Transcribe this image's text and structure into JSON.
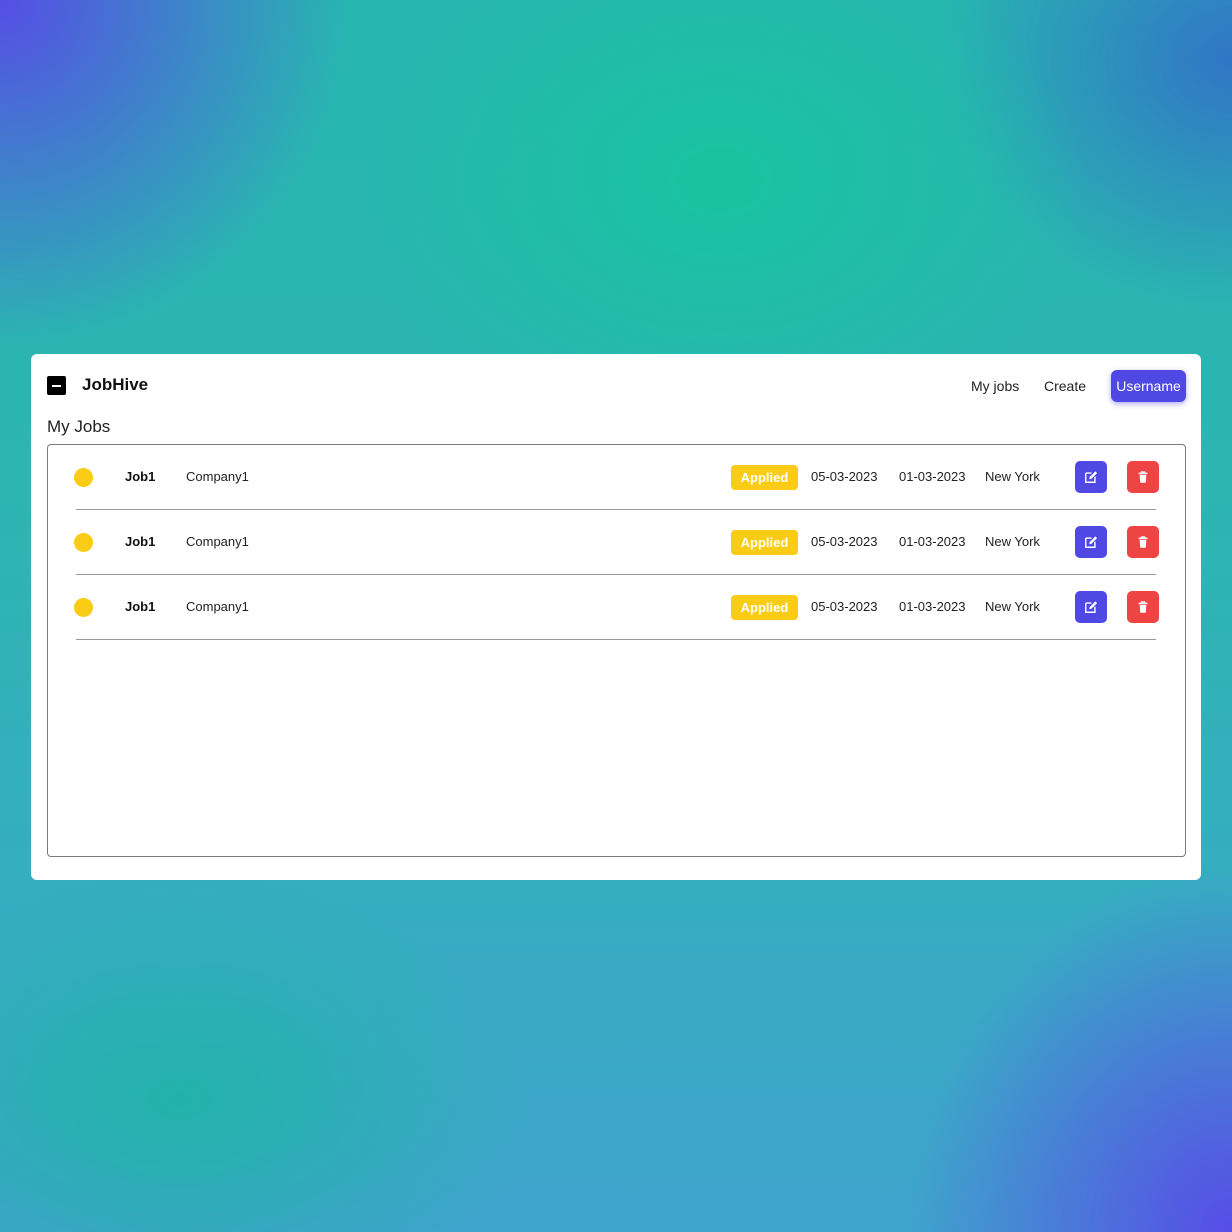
{
  "navbar": {
    "brand": "JobHive",
    "links": [
      "My jobs",
      "Create"
    ],
    "user_button": "Username"
  },
  "main": {
    "title": "My Jobs",
    "jobs": [
      {
        "title": "Job1",
        "company": "Company1",
        "status": "Applied",
        "date1": "05-03-2023",
        "date2": "01-03-2023",
        "location": "New York"
      },
      {
        "title": "Job1",
        "company": "Company1",
        "status": "Applied",
        "date1": "05-03-2023",
        "date2": "01-03-2023",
        "location": "New York"
      },
      {
        "title": "Job1",
        "company": "Company1",
        "status": "Applied",
        "date1": "05-03-2023",
        "date2": "01-03-2023",
        "location": "New York"
      }
    ]
  },
  "icons": {
    "logo": "minus-square-icon",
    "status_dot": "status-dot-icon",
    "edit": "edit-icon",
    "delete": "trash-icon"
  },
  "colors": {
    "accent": "#5048e5",
    "danger": "#ef4444",
    "status_applied": "#facc15"
  }
}
